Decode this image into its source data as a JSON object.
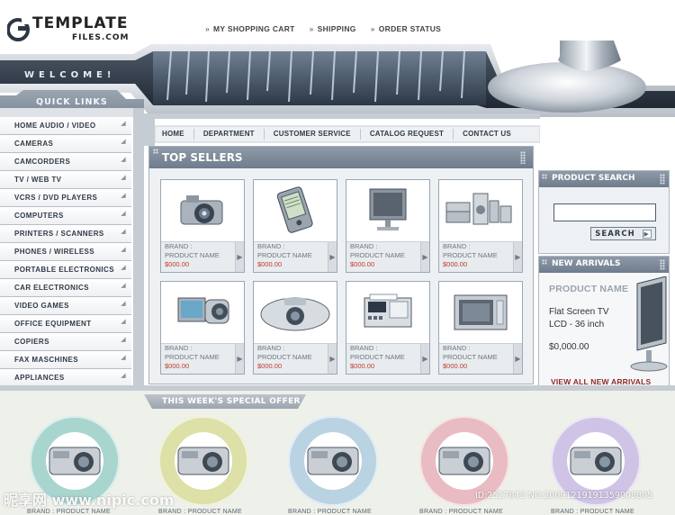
{
  "logo": {
    "title": "TEMPLATE",
    "subtitle": "FILES.COM"
  },
  "topnav": [
    "MY SHOPPING CART",
    "SHIPPING",
    "ORDER STATUS"
  ],
  "banner": {
    "welcome": "WELCOME!"
  },
  "quick_links": {
    "title": "QUICK LINKS",
    "items": [
      "HOME AUDIO / VIDEO",
      "CAMERAS",
      "CAMCORDERS",
      "TV / WEB TV",
      "VCRS / DVD PLAYERS",
      "COMPUTERS",
      "PRINTERS / SCANNERS",
      "PHONES / WIRELESS",
      "PORTABLE ELECTRONICS",
      "CAR ELECTRONICS",
      "VIDEO GAMES",
      "OFFICE EQUIPMENT",
      "COPIERS",
      "FAX MASCHINES",
      "APPLIANCES"
    ]
  },
  "mainnav": [
    "HOME",
    "DEPARTMENT",
    "CUSTOMER SERVICE",
    "CATALOG REQUEST",
    "CONTACT US"
  ],
  "top_sellers": {
    "title": "TOP SELLERS",
    "products": [
      {
        "brand": "BRAND :",
        "name": "PRODUCT NAME",
        "price": "$000.00",
        "icon": "digital-camera-icon"
      },
      {
        "brand": "BRAND :",
        "name": "PRODUCT NAME",
        "price": "$000.00",
        "icon": "pda-icon"
      },
      {
        "brand": "BRAND :",
        "name": "PRODUCT NAME",
        "price": "$000.00",
        "icon": "monitor-icon"
      },
      {
        "brand": "BRAND :",
        "name": "PRODUCT NAME",
        "price": "$000.00",
        "icon": "stereo-system-icon"
      },
      {
        "brand": "BRAND :",
        "name": "PRODUCT NAME",
        "price": "$000.00",
        "icon": "camcorder-icon"
      },
      {
        "brand": "BRAND :",
        "name": "PRODUCT NAME",
        "price": "$000.00",
        "icon": "projector-icon"
      },
      {
        "brand": "BRAND :",
        "name": "PRODUCT NAME",
        "price": "$000.00",
        "icon": "fax-machine-icon"
      },
      {
        "brand": "BRAND :",
        "name": "PRODUCT NAME",
        "price": "$000.00",
        "icon": "microwave-icon"
      }
    ]
  },
  "product_search": {
    "title": "PRODUCT SEARCH",
    "input_value": "",
    "button": "SEARCH"
  },
  "new_arrivals": {
    "title": "NEW ARRIVALS",
    "product_name": "PRODUCT NAME",
    "description": "Flat Screen TV LCD - 36 inch",
    "price": "$0,000.00",
    "link": "VIEW ALL NEW ARRIVALS"
  },
  "special_offer": {
    "title": "THIS WEEK'S SPECIAL OFFER",
    "rings": [
      {
        "color": "#a9d5cf",
        "caption": "BRAND : PRODUCT NAME"
      },
      {
        "color": "#dde0a7",
        "caption": "BRAND : PRODUCT NAME"
      },
      {
        "color": "#b9d3e3",
        "caption": "BRAND : PRODUCT NAME"
      },
      {
        "color": "#e8bcc2",
        "caption": "BRAND : PRODUCT NAME"
      },
      {
        "color": "#cfc3e6",
        "caption": "BRAND : PRODUCT NAME"
      }
    ]
  },
  "watermark": {
    "left": "昵享网 www.nipic.com",
    "right": "ID:2527843 NO:20091219191359008805"
  },
  "colors": {
    "nav_gray": "#7a8696",
    "panel_bg": "#eef1f4",
    "price_red": "#c0392b",
    "link_red": "#8e2b2b"
  }
}
